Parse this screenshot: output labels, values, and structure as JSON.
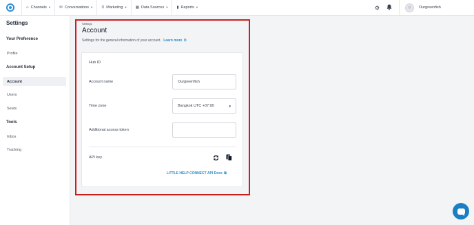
{
  "topbar": {
    "logo": "app-logo",
    "nav": [
      {
        "label": "Channels",
        "icon": "code-icon"
      },
      {
        "label": "Conversations",
        "icon": "chat-icon"
      },
      {
        "label": "Marketing",
        "icon": "antenna-icon"
      },
      {
        "label": "Data Sources",
        "icon": "grid-icon"
      },
      {
        "label": "Reports",
        "icon": "bar-chart-icon"
      }
    ],
    "user_name": "Ourgreenfish"
  },
  "sidebar": {
    "title": "Settings",
    "sections": [
      {
        "heading": "Your Preference",
        "items": [
          "Profile"
        ]
      },
      {
        "heading": "Account Setup",
        "items": [
          "Account",
          "Users",
          "Seats"
        ]
      },
      {
        "heading": "Tools",
        "items": [
          "Inbox",
          "Tracking"
        ]
      }
    ],
    "active_item": "Account"
  },
  "main": {
    "breadcrumb": "Settings",
    "title": "Account",
    "subtitle": "Settings for the general information of your account.",
    "learn_more": "Learn more",
    "hub_id_label": "Hub ID",
    "account_name_label": "Account name",
    "account_name_value": "Ourgreenfish",
    "time_zone_label": "Time zone",
    "time_zone_value": "Bangkok UTC +07:00",
    "access_token_label": "Additional access token",
    "access_token_value": "",
    "api_key_label": "API key",
    "docs_link": "LITTLE HELP CONNECT API Docs"
  },
  "colors": {
    "accent": "#1f8bc9",
    "highlight_border": "#c81f1f",
    "chat_button": "#1b7fc4"
  }
}
